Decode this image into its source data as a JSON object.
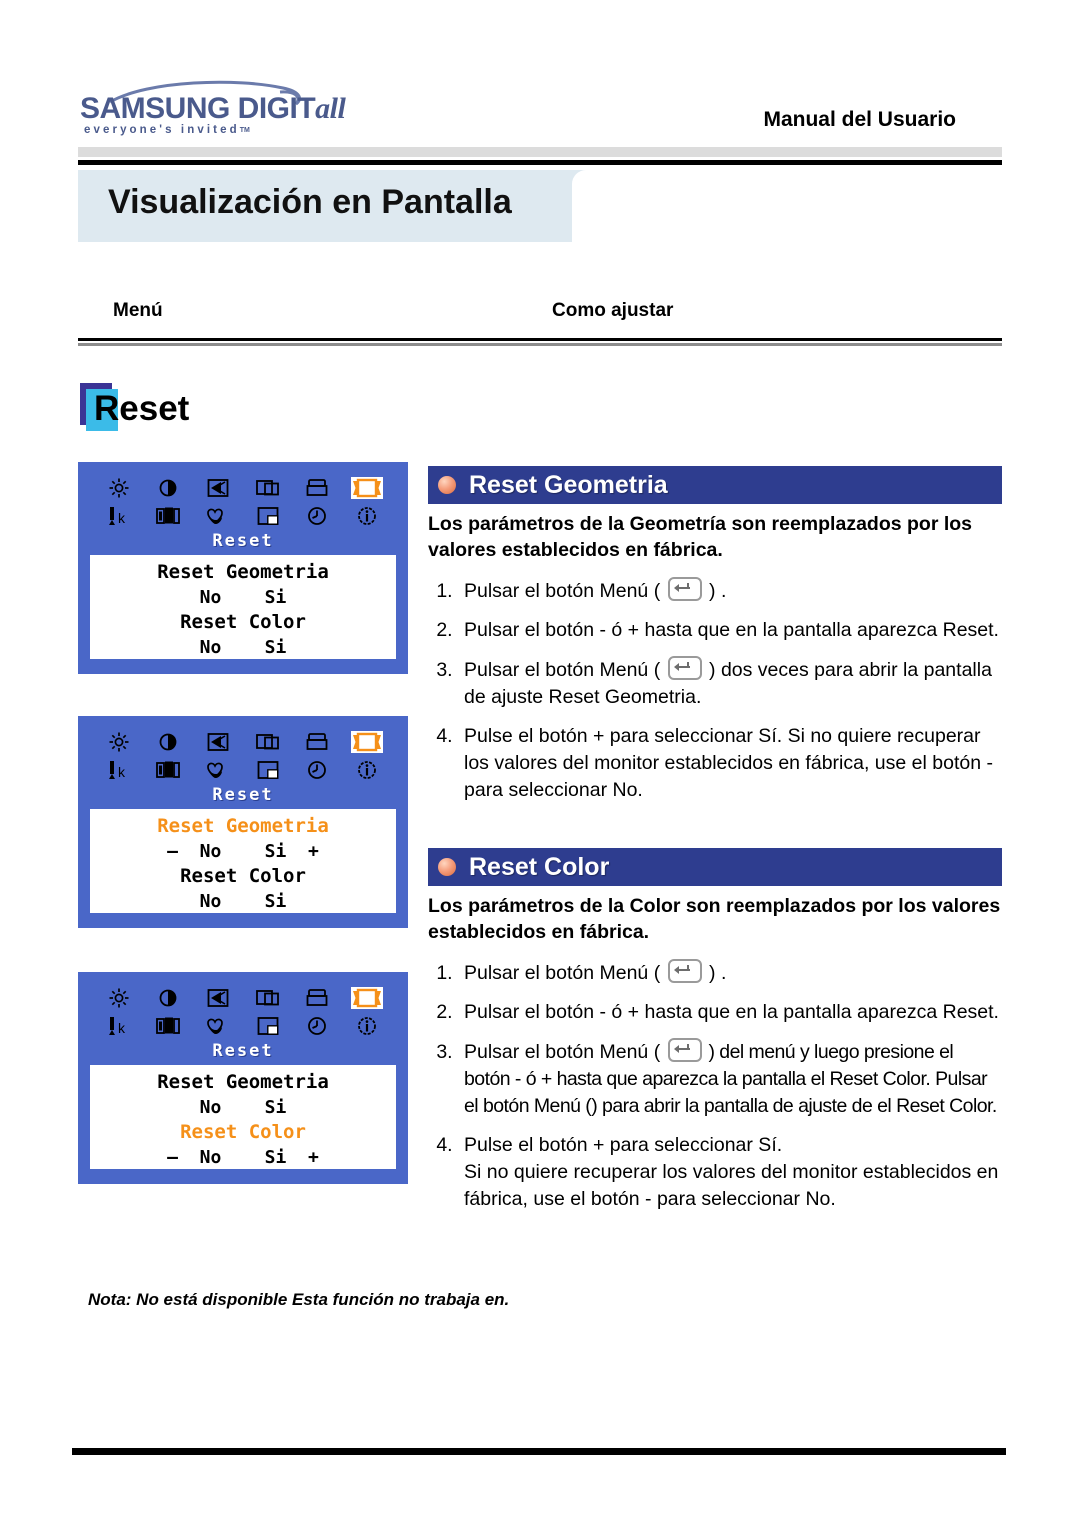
{
  "brand": {
    "logo_main": "SAMSUNG DIGIT",
    "logo_main_italic": "all",
    "logo_sub": "everyone's invited",
    "logo_tm": "TM"
  },
  "header": {
    "manual_title": "Manual del Usuario",
    "page_title": "Visualización en Pantalla"
  },
  "columns": {
    "menu_label": "Menú",
    "how_label": "Como ajustar"
  },
  "badge": {
    "label": "Reset"
  },
  "osd_panels": [
    {
      "category": "Reset",
      "lines": [
        {
          "text": "Reset Geometria",
          "highlight": false,
          "align": "center"
        },
        {
          "text": "No    Si",
          "highlight": false,
          "align": "center"
        },
        {
          "text": "Reset Color",
          "highlight": false,
          "align": "center"
        },
        {
          "text": "No    Si",
          "highlight": false,
          "align": "center"
        }
      ]
    },
    {
      "category": "Reset",
      "lines": [
        {
          "text": "Reset Geometria",
          "highlight": true,
          "align": "center"
        },
        {
          "text": "–  No    Si  +",
          "highlight": false,
          "align": "center"
        },
        {
          "text": "Reset Color",
          "highlight": false,
          "align": "center"
        },
        {
          "text": "No    Si",
          "highlight": false,
          "align": "center"
        }
      ]
    },
    {
      "category": "Reset",
      "lines": [
        {
          "text": "Reset Geometria",
          "highlight": false,
          "align": "center"
        },
        {
          "text": "No    Si",
          "highlight": false,
          "align": "center"
        },
        {
          "text": "Reset Color",
          "highlight": true,
          "align": "center"
        },
        {
          "text": "–  No    Si  +",
          "highlight": false,
          "align": "center"
        }
      ]
    }
  ],
  "osd_icons": [
    "brightness-icon",
    "contrast-icon",
    "moire-icon",
    "h-position-icon",
    "image-size-icon",
    "reset-icon",
    "color-temperature-icon",
    "color-control-icon",
    "color-tune-icon",
    "v-position-icon",
    "osd-timer-icon",
    "information-icon"
  ],
  "sections": [
    {
      "title": "Reset Geometria",
      "description": "Los parámetros de la Geometría son reemplazados por los valores establecidos en fábrica.",
      "steps": [
        {
          "pre": "Pulsar el botón Menú ( ",
          "button": true,
          "post": " ) ."
        },
        {
          "pre": "Pulsar el botón - ó + hasta que en la pantalla aparezca Reset.",
          "button": false,
          "post": ""
        },
        {
          "pre": "Pulsar el botón Menú ( ",
          "button": true,
          "post": " ) dos veces para abrir la pantalla de ajuste Reset Geometria."
        },
        {
          "pre": "Pulse el botón + para seleccionar Sí. Si no quiere recuperar los valores del monitor establecidos en fábrica, use el botón - para seleccionar No.",
          "button": false,
          "post": ""
        }
      ]
    },
    {
      "title": "Reset Color",
      "description": "Los parámetros de la Color son reemplazados por los valores establecidos en fábrica.",
      "steps": [
        {
          "pre": "Pulsar el botón Menú ( ",
          "button": true,
          "post": " ) ."
        },
        {
          "pre": "Pulsar el botón - ó + hasta que en la pantalla aparezca Reset.",
          "button": false,
          "post": ""
        },
        {
          "pre": "Pulsar el botón Menú ( ",
          "button": true,
          "post": " ) del menú y luego presione el botón - ó + hasta que aparezca la pantalla el Reset Color. Pulsar el botón Menú () para abrir la pantalla de ajuste de el Reset Color."
        },
        {
          "pre": "Pulse el botón + para seleccionar Sí.\nSi no quiere recuperar los valores del monitor establecidos en fábrica, use el botón - para seleccionar No.",
          "button": false,
          "post": ""
        }
      ]
    }
  ],
  "note": "Nota: No está disponible  Esta función no trabaja en.",
  "colors": {
    "osd_background": "#4a67c8",
    "osd_highlight": "#f59019",
    "section_header": "#2e3d8f",
    "banner": "#dee9f0",
    "badge_back": "#3b3496",
    "badge_front": "#3bbbe8",
    "brand": "#4a5a8c"
  }
}
